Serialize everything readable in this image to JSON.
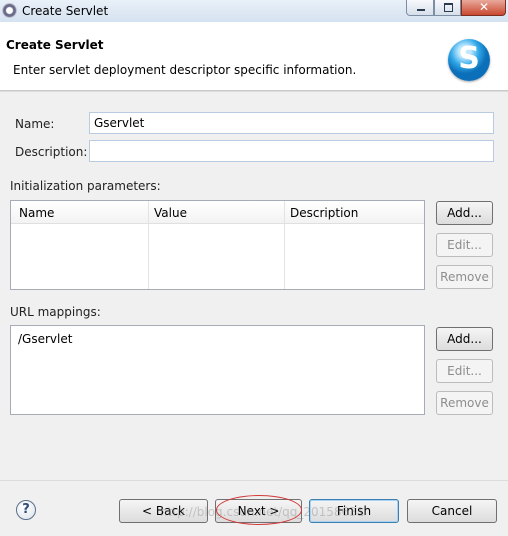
{
  "window": {
    "title": "Create Servlet",
    "close_glyph": "✕"
  },
  "banner": {
    "title": "Create Servlet",
    "description": "Enter servlet deployment descriptor specific information.",
    "logo_letter": "S"
  },
  "form": {
    "name_label": "Name:",
    "name_value": "Gservlet",
    "description_label": "Description:",
    "description_value": ""
  },
  "init_params": {
    "label": "Initialization parameters:",
    "columns": [
      "Name",
      "Value",
      "Description"
    ],
    "buttons": {
      "add": "Add...",
      "edit": "Edit...",
      "remove": "Remove"
    }
  },
  "url_mappings": {
    "label": "URL mappings:",
    "items": [
      "/Gservlet"
    ],
    "buttons": {
      "add": "Add...",
      "edit": "Edit...",
      "remove": "Remove"
    }
  },
  "footer": {
    "help": "?",
    "back": "< Back",
    "next": "Next >",
    "finish": "Finish",
    "cancel": "Cancel",
    "watermark": "http://blog.csdn.net/qq_20158631"
  },
  "colors": {
    "annotation_ellipse": "#d23a3a",
    "default_button_border": "#3c7fb1"
  }
}
